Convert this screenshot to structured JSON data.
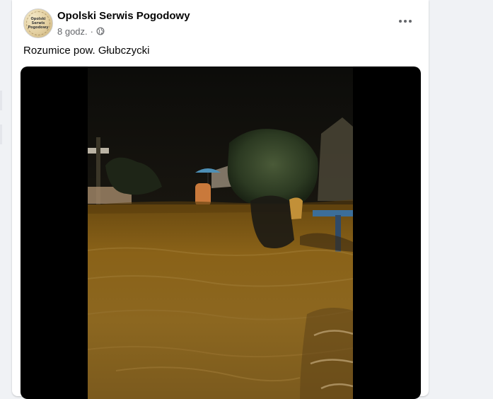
{
  "post": {
    "author": "Opolski Serwis Pogodowy",
    "avatar_text": "Opolski Serwis Pogodowy",
    "time": "8 godz.",
    "separator": "·",
    "audience_icon": "globe-icon",
    "more_icon": "more-horizontal-icon",
    "text": "Rozumice pow. Głubczycki"
  },
  "colors": {
    "background": "#f0f2f5",
    "card": "#ffffff",
    "primary_text": "#050505",
    "secondary_text": "#65676b",
    "video_letterbox": "#000000"
  }
}
